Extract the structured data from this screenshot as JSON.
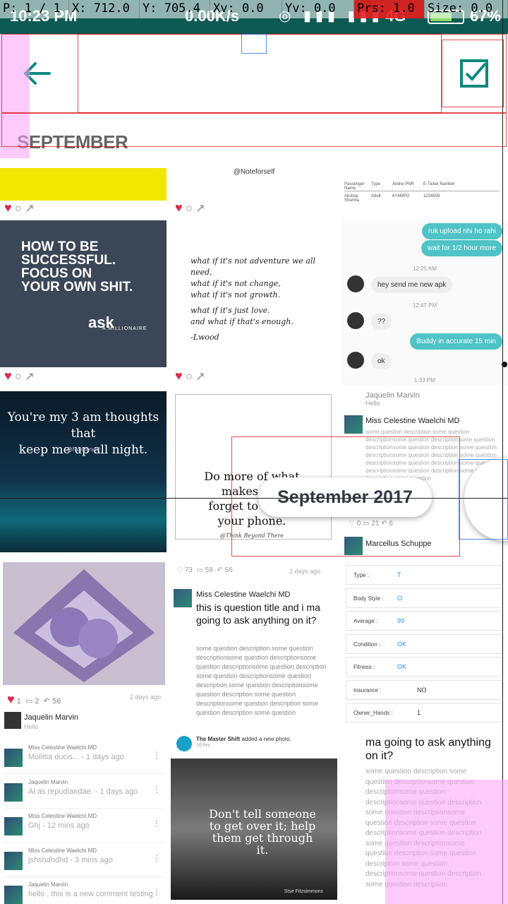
{
  "status_bar": {
    "time": "10:23 PM",
    "speed": "0.00K/s",
    "network": "4G",
    "battery": "67%"
  },
  "pointer_overlay": {
    "p": "P: 1 / 1",
    "x": "X: 712.0",
    "y": "Y: 705.4",
    "xv": "Xv: 0.0",
    "yv": "Yv: 0.0",
    "prs": "Prs: 1.0",
    "size": "Size: 0.0"
  },
  "app_bar": {
    "back_icon": "arrow-left",
    "confirm_icon": "check-box",
    "accent": "#0b8a7e"
  },
  "section": {
    "title": "SEPTEMBER"
  },
  "tiles": {
    "row1": {
      "c2_caption": "@Noteforself",
      "c3_table": {
        "headers": [
          "Passenger Name",
          "Type",
          "Airline PNR",
          "E-Ticket Number"
        ],
        "row": [
          "Akshay Sharma",
          "Adult",
          "6Y4MPO",
          "1234509"
        ]
      }
    },
    "ask": {
      "line1": "HOW TO BE",
      "line2": "SUCCESSFUL.",
      "line3": "FOCUS ON",
      "line4": "YOUR OWN SHIT.",
      "logo": "ask",
      "logo_sub": "A MILLIONAIRE"
    },
    "quote": {
      "l1": "what if it's not adventure we all need,",
      "l2": "what if it's not change,",
      "l3": "what if it's not growth.",
      "l4": "what if it's just love.",
      "l5": "and what if that's enough.",
      "l6": "-Lwood"
    },
    "chat": {
      "out1": "ruk upload nhi ho rahi",
      "out2": "wait for 1/2 hour more",
      "time1": "12:25 AM",
      "in1": "hey send me new apk",
      "time2": "12:47 PM",
      "in2": "??",
      "out3": "Buddy in accurate 15 min",
      "in3": "ok",
      "time3": "1:33 PM"
    },
    "night": {
      "line1": "You're my 3 am thoughts that",
      "line2": "keep me up all night.",
      "credit": "@Noteforself"
    },
    "frame_quote": {
      "line1": "Do more of what",
      "line2": "makes you",
      "line3": "forget to check",
      "line4": "your phone.",
      "credit": "@Think Beyond There"
    },
    "post_tile": {
      "header_name": "Jaquelin Marvin",
      "header_sub": "Hello",
      "author": "Miss Celestine Waelchi MD",
      "counts": [
        "0",
        "21",
        "6"
      ],
      "author2": "Marcellus Schuppe"
    },
    "craft": {
      "likes": "1",
      "comments": "2",
      "shares": "56",
      "ago": "2 days ago",
      "name": "Jaquelin Marvin",
      "sub": "Hello"
    },
    "question": {
      "likes": "73",
      "comments": "58",
      "shares": "56",
      "ago": "2 days ago",
      "author": "Miss Celestine Waelchi MD",
      "title": "this is question title and i ma going to ask anything on it?",
      "body": "some question description some question descriptionsome question descriptionsome question descriptionsome question description some question descriptionsome question description some question descriptionsome question description some question descriptionsome question description some question description some question"
    },
    "form": {
      "rows": [
        {
          "k": "Type :",
          "v": "T"
        },
        {
          "k": "Body Style :",
          "v": "O"
        },
        {
          "k": "Average :",
          "v": "99"
        },
        {
          "k": "Condition :",
          "v": "OK"
        },
        {
          "k": "Fitness :",
          "v": "OK"
        },
        {
          "k": "Insurance :",
          "v": "NO"
        },
        {
          "k": "Owner_Hands :",
          "v": "1"
        }
      ]
    },
    "comments": [
      {
        "name": "Miss Celestine Waelchi MD",
        "text": "Mollitia ducis... - 1 days ago"
      },
      {
        "name": "Jaquelin Marvin",
        "text": "Al as repudiandae. - 1 days ago"
      },
      {
        "name": "Miss Celestine Waelchi MD",
        "text": "Ghj - 12 mins ago"
      },
      {
        "name": "Miss Celestine Waelchi MD",
        "text": "jshshdhdhd - 3 mins ago"
      },
      {
        "name": "Jaquelin Marvin",
        "text": "hello , this is a new comment testing"
      }
    ],
    "master_shift": {
      "page": "The Master Shift",
      "action": "added a new photo.",
      "time": "16 hrs",
      "quote1": "Don't tell someone",
      "quote2": "to get over it; help",
      "quote3": "them get through",
      "quote4": "it.",
      "sign": "Stse Fitzsimmons"
    },
    "question2": {
      "title": "ma going to ask anything on it?",
      "body": "some question description some question descriptionsome question descriptionsome question descriptionsome question description some question descriptionsome question description some question descriptionsome question description some question descriptionsome question description some question description some question descriptionsome question description some question description"
    }
  },
  "date_popup": "September 2017"
}
